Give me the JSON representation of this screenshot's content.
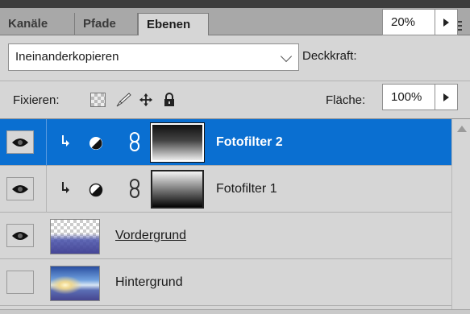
{
  "tabs": [
    {
      "label": "Kanäle",
      "active": false
    },
    {
      "label": "Pfade",
      "active": false
    },
    {
      "label": "Ebenen",
      "active": true
    }
  ],
  "panel_menu_icon": "panel-menu-icon",
  "blend_mode": {
    "value": "Ineinanderkopieren"
  },
  "opacity": {
    "label": "Deckkraft:",
    "value": "20%"
  },
  "lock": {
    "label": "Fixieren:",
    "icons": [
      "transparency-lock-icon",
      "brush-lock-icon",
      "move-lock-icon",
      "lock-icon"
    ]
  },
  "fill": {
    "label": "Fläche:",
    "value": "100%"
  },
  "layers": [
    {
      "name": "Fotofilter 2",
      "visible": true,
      "selected": true,
      "clipped": true,
      "type": "adjustment"
    },
    {
      "name": "Fotofilter 1",
      "visible": true,
      "selected": false,
      "clipped": true,
      "type": "adjustment"
    },
    {
      "name": "Vordergrund",
      "visible": true,
      "selected": false,
      "type": "image"
    },
    {
      "name": "Hintergrund",
      "visible": false,
      "selected": false,
      "type": "image"
    }
  ],
  "colors": {
    "selection": "#0a6fd1",
    "panel_bg": "#d6d6d6"
  }
}
